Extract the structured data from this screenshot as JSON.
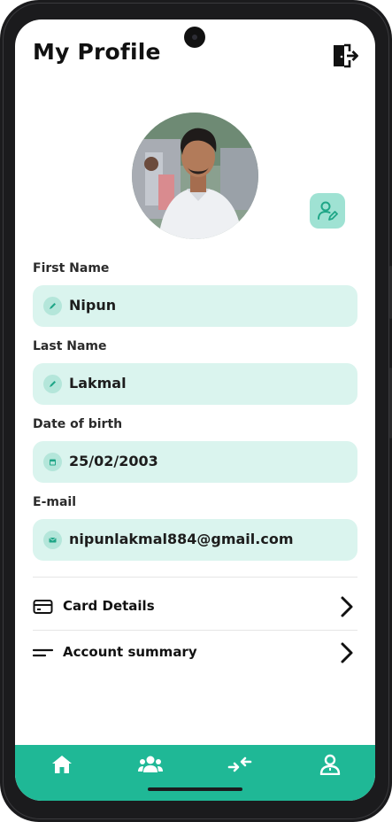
{
  "header": {
    "title": "My Profile"
  },
  "fields": [
    {
      "label": "First Name",
      "value": "Nipun"
    },
    {
      "label": "Last Name",
      "value": "Lakmal"
    },
    {
      "label": "Date of birth",
      "value": "25/02/2003"
    },
    {
      "label": "E-mail",
      "value": "nipunlakmal884@gmail.com"
    }
  ],
  "menu": {
    "card_details": "Card Details",
    "account_summary": "Account summary"
  },
  "nav": {
    "items": [
      "home-icon",
      "group-icon",
      "transfer-icon",
      "profile-icon"
    ]
  },
  "colors": {
    "accent": "#1fb896",
    "field_bg": "#daf4ee",
    "icon_bg": "#9fe2d3"
  }
}
